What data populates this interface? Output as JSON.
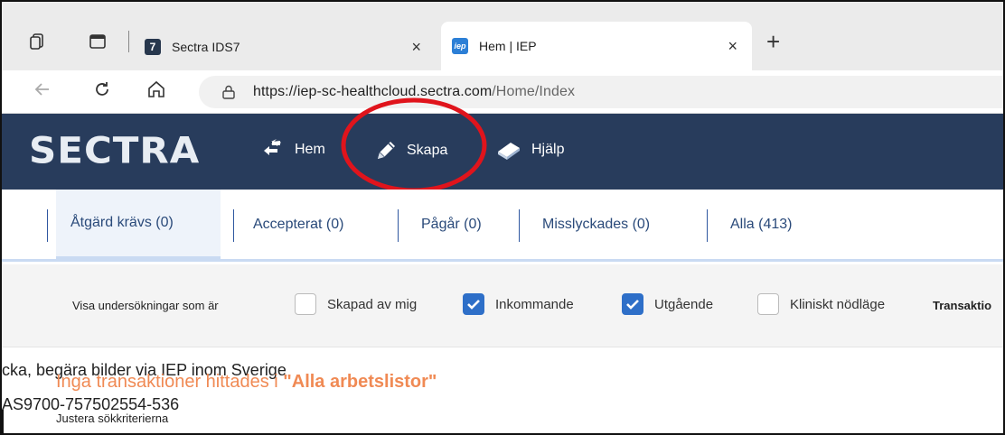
{
  "browser": {
    "tabs": [
      {
        "title": "Sectra IDS7",
        "favicon": "7",
        "active": false
      },
      {
        "title": "Hem | IEP",
        "favicon": "iep",
        "active": true
      }
    ],
    "close_glyph": "×",
    "newtab_glyph": "+",
    "url_host": "https://iep-sc-healthcloud.sectra.com",
    "url_path": "/Home/Index"
  },
  "app": {
    "logo": "SECTRA",
    "nav": [
      {
        "label": "Hem",
        "icon": "swap-arrows-icon"
      },
      {
        "label": "Skapa",
        "icon": "pencil-icon"
      },
      {
        "label": "Hjälp",
        "icon": "book-icon"
      }
    ],
    "annotation_color": "#e0141c"
  },
  "worklist_tabs": [
    {
      "label": "Åtgärd krävs (0)",
      "active": true
    },
    {
      "label": "Accepterat (0)",
      "active": false
    },
    {
      "label": "Pågår (0)",
      "active": false
    },
    {
      "label": "Misslyckades (0)",
      "active": false
    },
    {
      "label": "Alla (413)",
      "active": false
    }
  ],
  "filters": {
    "label": "Visa undersökningar som är",
    "options": [
      {
        "label": "Skapad av mig",
        "checked": false
      },
      {
        "label": "Inkommande",
        "checked": true
      },
      {
        "label": "Utgående",
        "checked": true
      },
      {
        "label": "Kliniskt nödläge",
        "checked": false
      }
    ],
    "truncated_label": "Transaktio"
  },
  "content": {
    "overlay_line1": "cka, begära bilder via IEP inom Sverige",
    "overlay_line2": "AS9700-757502554-536",
    "notfound_prefix": "Inga transaktioner hittades i ",
    "notfound_worklist": "\"Alla arbetslistor\"",
    "adjust_hint": "Justera sökkriterierna"
  },
  "colors": {
    "header_bg": "#283c5c",
    "accent_blue": "#2e6fc8",
    "notfound_orange": "#f08a54"
  }
}
